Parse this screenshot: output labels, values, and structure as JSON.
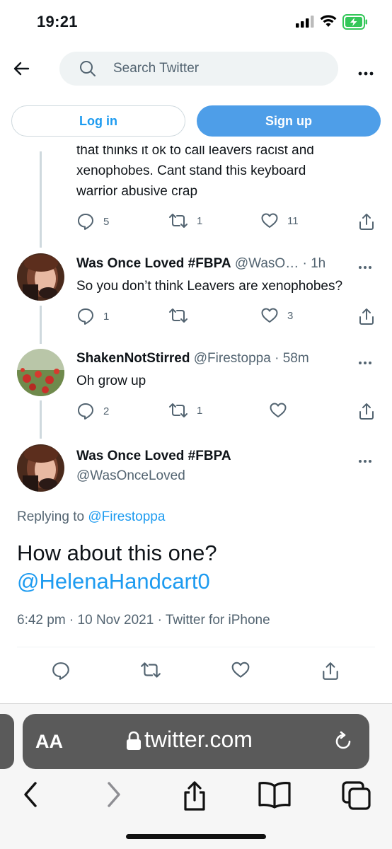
{
  "status_bar": {
    "time": "19:21",
    "icons": [
      "signal-icon",
      "wifi-icon",
      "battery-charging-icon"
    ],
    "battery_color": "#34c759"
  },
  "header": {
    "search_placeholder": "Search Twitter",
    "icons": [
      "back-arrow-icon",
      "search-icon",
      "more-icon"
    ]
  },
  "auth": {
    "login_label": "Log in",
    "signup_label": "Sign up",
    "accent_color": "#1d9bf0"
  },
  "tweets": [
    {
      "text_lines": [
        "that thinks it ok to call leavers racist and",
        "xenophobes. Cant stand this keyboard",
        "warrior abusive crap"
      ],
      "replies": "5",
      "retweets": "1",
      "likes": "11"
    },
    {
      "name": "Was Once Loved #FBPA",
      "handle": "@WasO…",
      "time": "· 1h",
      "text": "So you don’t think Leavers are xenophobes?",
      "replies": "1",
      "retweets": "",
      "likes": "3"
    },
    {
      "name": "ShakenNotStirred",
      "handle": "@Firestoppa",
      "time": "· 58m",
      "text": "Oh grow up",
      "replies": "2",
      "retweets": "1",
      "likes": ""
    }
  ],
  "main_tweet": {
    "name": "Was Once Loved #FBPA",
    "handle": "@WasOnceLoved",
    "replying_prefix": "Replying to",
    "replying_to": "@Firestoppa",
    "text": "How about this one?",
    "mention": "@HelenaHandcart0",
    "timestamp": "6:42 pm · 10 Nov 2021 · Twitter for iPhone"
  },
  "safari": {
    "aa_label": "AA",
    "url": "twitter.com",
    "icons": [
      "lock-icon",
      "reload-icon",
      "back-icon",
      "forward-icon",
      "share-icon",
      "bookmarks-icon",
      "tabs-icon"
    ]
  }
}
